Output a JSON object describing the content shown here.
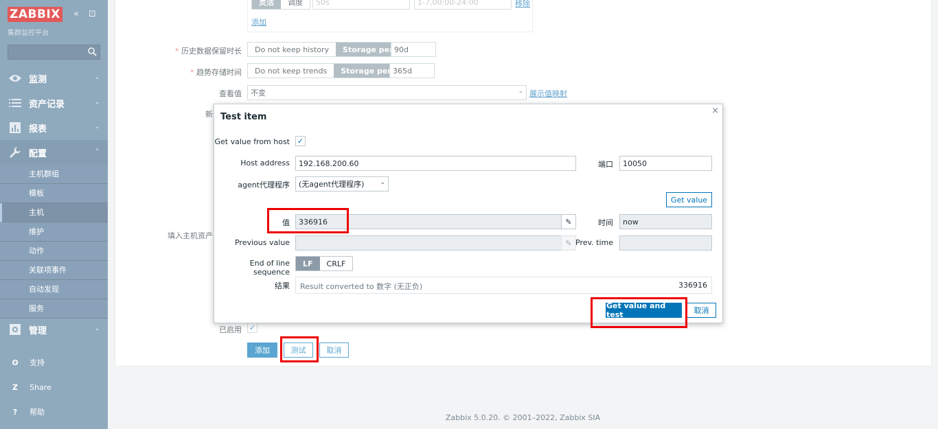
{
  "sidebar": {
    "logo": "ZABBIX",
    "subtitle": "集群监控平台",
    "collapse_icon": "«",
    "kiosk_icon": "⊡",
    "menu": [
      {
        "label": "监测",
        "icon": "eye-icon"
      },
      {
        "label": "资产记录",
        "icon": "list-icon"
      },
      {
        "label": "报表",
        "icon": "bar-chart-icon"
      },
      {
        "label": "配置",
        "icon": "wrench-icon"
      },
      {
        "label": "管理",
        "icon": "gear-icon"
      }
    ],
    "submenu": [
      "主机群组",
      "模板",
      "主机",
      "维护",
      "动作",
      "关联项事件",
      "自动发现",
      "服务"
    ],
    "support": [
      {
        "label": "支持",
        "icon": "headset-icon"
      },
      {
        "label": "Share",
        "icon": "share-icon"
      },
      {
        "label": "帮助",
        "icon": "help-icon"
      }
    ]
  },
  "form": {
    "top_seg": [
      "灵活",
      "调度"
    ],
    "top_interval": "50s",
    "top_period": "1-7,00:00-24:00",
    "top_remove": "移除",
    "top_add": "添加",
    "history_label": "历史数据保留时长",
    "history_seg": [
      "Do not keep history",
      "Storage period"
    ],
    "history_value": "90d",
    "trends_label": "趋势存储时间",
    "trends_seg": [
      "Do not keep trends",
      "Storage period"
    ],
    "trends_value": "365d",
    "valuemap_label": "查看值",
    "valuemap_value": "不变",
    "valuemap_link": "展示值映射",
    "new_app_label": "新",
    "inventory_label": "填入主机资产纪",
    "enabled_label": "已启用",
    "btn_add": "添加",
    "btn_test": "测试",
    "btn_cancel": "取消"
  },
  "modal": {
    "title": "Test item",
    "close": "×",
    "get_value_from_host": "Get value from host",
    "host_address_label": "Host address",
    "host_address": "192.168.200.60",
    "port_label": "端口",
    "port": "10050",
    "proxy_label": "agent代理程序",
    "proxy_value": "(无agent代理程序)",
    "get_value_btn": "Get value",
    "value_label": "值",
    "value": "336916",
    "time_label": "时间",
    "time_value": "now",
    "prev_value_label": "Previous value",
    "prev_time_label": "Prev. time",
    "eol_label": "End of line sequence",
    "eol_options": [
      "LF",
      "CRLF"
    ],
    "result_label": "结果",
    "result_text": "Result converted to 数字 (无正负)",
    "result_value": "336916",
    "btn_test": "Get value and test",
    "btn_cancel": "取消"
  },
  "footer": "Zabbix 5.0.20. © 2001–2022, Zabbix SIA",
  "colors": {
    "accent": "#0275b8",
    "highlight": "#ee0000",
    "logo_bg": "#d40000",
    "sidebar_bg": "#537b9a"
  }
}
